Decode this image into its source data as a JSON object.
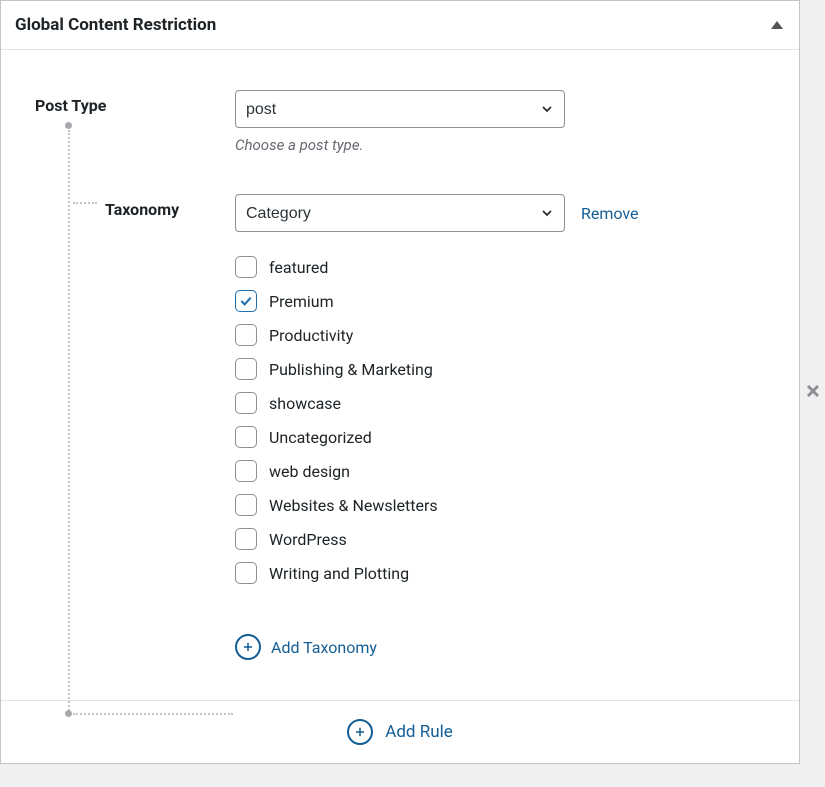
{
  "header": {
    "title": "Global Content Restriction"
  },
  "postType": {
    "label": "Post Type",
    "value": "post",
    "helper": "Choose a post type."
  },
  "taxonomy": {
    "label": "Taxonomy",
    "value": "Category",
    "removeLabel": "Remove",
    "terms": [
      {
        "label": "featured",
        "checked": false
      },
      {
        "label": "Premium",
        "checked": true
      },
      {
        "label": "Productivity",
        "checked": false
      },
      {
        "label": "Publishing & Marketing",
        "checked": false
      },
      {
        "label": "showcase",
        "checked": false
      },
      {
        "label": "Uncategorized",
        "checked": false
      },
      {
        "label": "web design",
        "checked": false
      },
      {
        "label": "Websites & Newsletters",
        "checked": false
      },
      {
        "label": "WordPress",
        "checked": false
      },
      {
        "label": "Writing and Plotting",
        "checked": false
      }
    ]
  },
  "actions": {
    "addTaxonomy": "Add Taxonomy",
    "addRule": "Add Rule"
  },
  "colors": {
    "link": "#135e96"
  }
}
